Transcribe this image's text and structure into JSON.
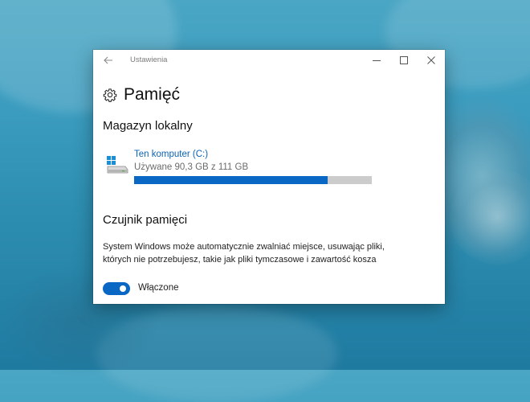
{
  "window": {
    "app_title": "Ustawienia",
    "controls": {
      "minimize": "minimize-icon",
      "maximize": "maximize-icon",
      "close": "close-icon"
    }
  },
  "header": {
    "title": "Pamięć",
    "icon": "gear-icon"
  },
  "local_storage": {
    "title": "Magazyn lokalny",
    "drive": {
      "name": "Ten komputer (C:)",
      "usage_text": "Używane 90,3 GB z 111 GB",
      "used_gb": 90.3,
      "total_gb": 111,
      "icon": "drive-icon"
    }
  },
  "storage_sense": {
    "title": "Czujnik pamięci",
    "description": "System Windows może automatycznie zwalniać miejsce, usuwając pliki, których nie potrzebujesz, takie jak pliki tymczasowe i zawartość kosza",
    "toggle_on": true,
    "toggle_label": "Włączone"
  },
  "colors": {
    "accent": "#0a67c4",
    "link": "#0a64b4",
    "bar_track": "#cccccc"
  }
}
